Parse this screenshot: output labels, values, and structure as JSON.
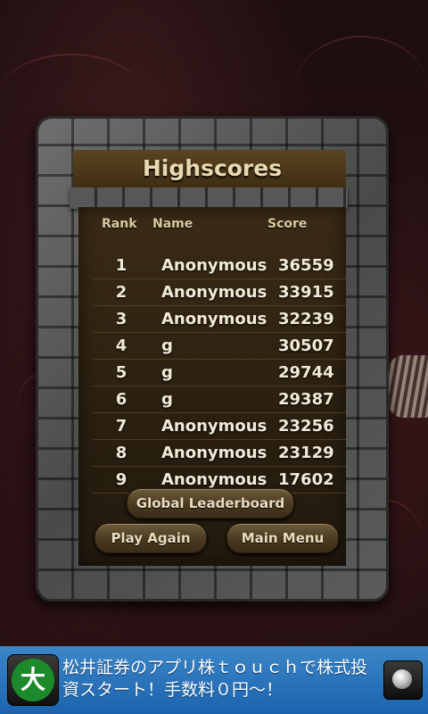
{
  "screen": {
    "title": "Highscores",
    "columns": {
      "rank": "Rank",
      "name": "Name",
      "score": "Score"
    },
    "rows": [
      {
        "rank": "1",
        "name": "Anonymous",
        "score": "36559"
      },
      {
        "rank": "2",
        "name": "Anonymous",
        "score": "33915"
      },
      {
        "rank": "3",
        "name": "Anonymous",
        "score": "32239"
      },
      {
        "rank": "4",
        "name": "g",
        "score": "30507"
      },
      {
        "rank": "5",
        "name": "g",
        "score": "29744"
      },
      {
        "rank": "6",
        "name": "g",
        "score": "29387"
      },
      {
        "rank": "7",
        "name": "Anonymous",
        "score": "23256"
      },
      {
        "rank": "8",
        "name": "Anonymous",
        "score": "23129"
      },
      {
        "rank": "9",
        "name": "Anonymous",
        "score": "17602"
      }
    ],
    "buttons": {
      "global_leaderboard": "Global Leaderboard",
      "play_again": "Play Again",
      "main_menu": "Main Menu"
    }
  },
  "ad": {
    "logo_char": "大",
    "text": "松井証券のアプリ株ｔｏｕｃｈで株式投資スタート！手数料０円～！",
    "icon": "globe-icon"
  },
  "colors": {
    "title": "#e8d9b0",
    "row_text": "#f2ead8",
    "ad_background": "#1c63ad"
  }
}
